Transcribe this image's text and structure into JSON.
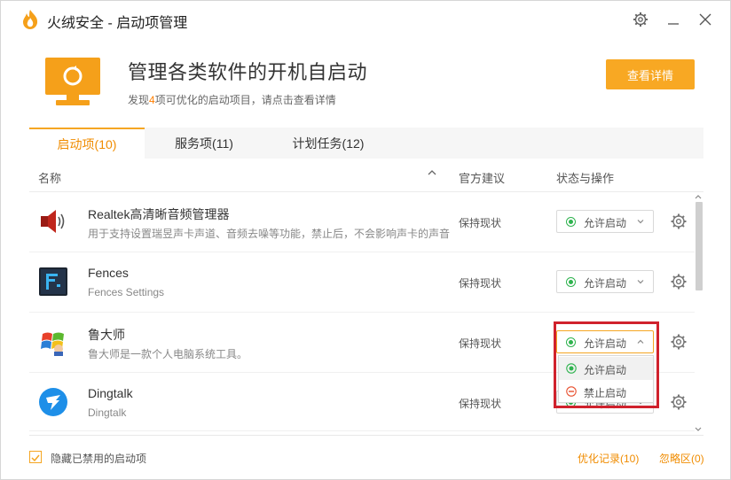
{
  "window": {
    "title": "火绒安全 - 启动项管理"
  },
  "hero": {
    "title": "管理各类软件的开机自启动",
    "subtitle_prefix": "发现",
    "subtitle_count": "4",
    "subtitle_suffix": "项可优化的启动项目，请点击查看详情",
    "details_button": "查看详情"
  },
  "tabs": [
    {
      "label": "启动项(10)",
      "active": true
    },
    {
      "label": "服务项(11)",
      "active": false
    },
    {
      "label": "计划任务(12)",
      "active": false
    }
  ],
  "table": {
    "headers": {
      "name": "名称",
      "advice": "官方建议",
      "status": "状态与操作"
    },
    "rows": [
      {
        "name": "Realtek高清晰音频管理器",
        "desc": "用于支持设置瑞昱声卡声道、音频去噪等功能，禁止后，不会影响声卡的声音",
        "advice": "保持现状",
        "status": "允许启动",
        "icon": "speaker-icon"
      },
      {
        "name": "Fences",
        "desc": "Fences Settings",
        "advice": "保持现状",
        "status": "允许启动",
        "icon": "fences-icon"
      },
      {
        "name": "鲁大师",
        "desc": "鲁大师是一款个人电脑系统工具。",
        "advice": "保持现状",
        "status": "允许启动",
        "icon": "ludashi-icon"
      },
      {
        "name": "Dingtalk",
        "desc": "Dingtalk",
        "advice": "保持现状",
        "status": "允许启动",
        "icon": "dingtalk-icon"
      }
    ]
  },
  "dropdown": {
    "options": [
      {
        "label": "允许启动",
        "color": "#2fb34f"
      },
      {
        "label": "禁止启动",
        "color": "#e8502f"
      }
    ]
  },
  "footer": {
    "hide_disabled_label": "隐藏已禁用的启动项",
    "history_link": "优化记录(10)",
    "ignore_link": "忽略区(0)"
  },
  "colors": {
    "accent": "#f5a623",
    "highlight": "#d0212c"
  }
}
